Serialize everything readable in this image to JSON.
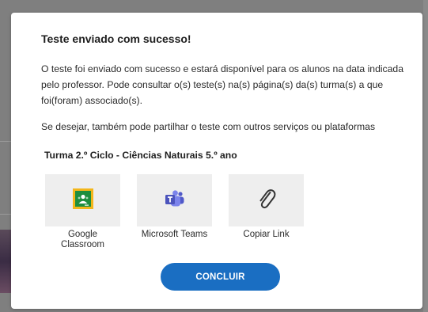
{
  "dialog": {
    "title": "Teste enviado com sucesso!",
    "message": "O teste foi enviado com sucesso e estará disponível para os alunos na data indicada pelo professor. Pode consultar o(s) teste(s) na(s) página(s) da(s) turma(s) a que foi(foram) associado(s).",
    "share_prompt": "Se desejar, também pode partilhar o teste com outros serviços ou plataformas",
    "class_name": "Turma 2.º Ciclo - Ciências Naturais 5.º ano",
    "share_options": [
      {
        "label": "Google Classroom",
        "icon": "google-classroom-icon"
      },
      {
        "label": "Microsoft Teams",
        "icon": "microsoft-teams-icon"
      },
      {
        "label": "Copiar Link",
        "icon": "paperclip-icon"
      }
    ],
    "conclude_label": "CONCLUIR"
  },
  "colors": {
    "accent": "#1a6ec2",
    "tile_bg": "#eeeeee",
    "classroom_yellow": "#f3b61a",
    "classroom_green": "#1e8e3e",
    "teams_purple": "#5059c9",
    "teams_purple_light": "#7b83eb",
    "backdrop": "#7f7f7f"
  }
}
